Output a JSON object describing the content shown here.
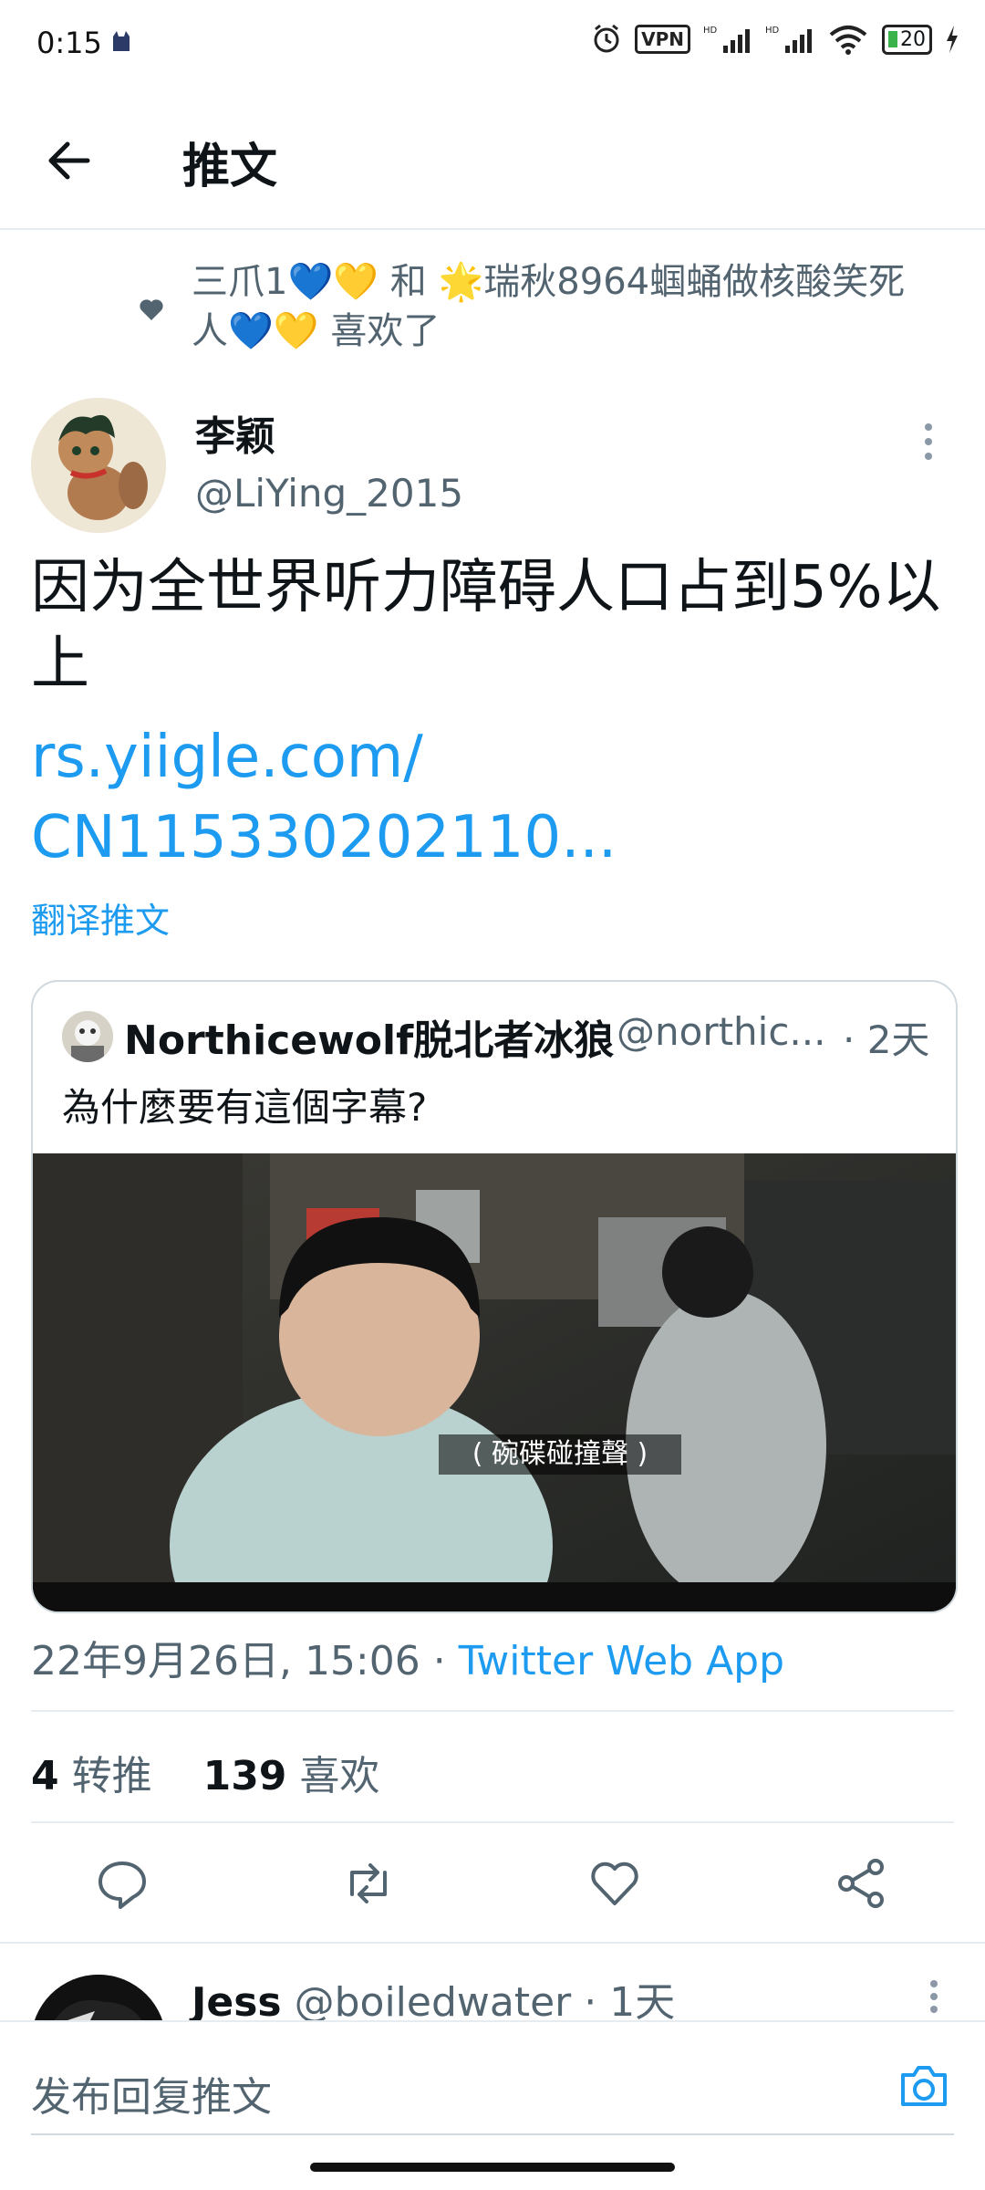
{
  "status_bar": {
    "time": "0:15",
    "vpn": "VPN",
    "battery": "20"
  },
  "header": {
    "title": "推文"
  },
  "liked_by": {
    "text": "三爪1💙💛 和 🌟瑞秋8964蝈蛹做核酸笑死人💙💛 喜欢了"
  },
  "tweet": {
    "author_name": "李颖",
    "author_handle": "@LiYing_2015",
    "text": "因为全世界听力障碍人口占到5%以上",
    "link": "rs.yiigle.com/ CN115330202110...",
    "translate": "翻译推文",
    "timestamp": "22年9月26日, 15:06 · ",
    "source": "Twitter Web App",
    "retweets_count": "4",
    "retweets_label": "转推",
    "likes_count": "139",
    "likes_label": "喜欢"
  },
  "quote": {
    "author_name": "Northicewolf脱北者冰狼",
    "author_handle": "@northic...",
    "time": "· 2天",
    "text": "為什麼要有這個字幕?",
    "media_subtitle": "( 碗碟碰撞聲 )"
  },
  "reply_preview": {
    "name": "Jess",
    "handle": "@boiledwater",
    "time": "· 1天"
  },
  "reply_bar": {
    "placeholder": "发布回复推文"
  },
  "colors": {
    "accent": "#1d9bf0",
    "secondary_text": "#536471",
    "divider": "#e6ecf0"
  },
  "icons": [
    "back-arrow-icon",
    "heart-icon",
    "more-vertical-icon",
    "reply-icon",
    "retweet-icon",
    "like-icon",
    "share-icon",
    "camera-icon"
  ]
}
